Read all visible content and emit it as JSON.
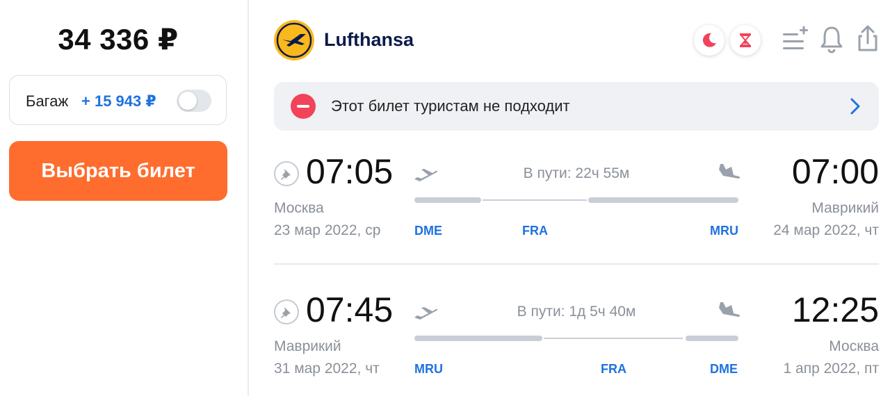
{
  "left": {
    "price": "34 336 ₽",
    "baggage_label": "Багаж",
    "baggage_price": "+ 15 943 ₽",
    "baggage_enabled": false,
    "select_button": "Выбрать билет"
  },
  "header": {
    "airline": "Lufthansa",
    "icons": [
      "night-flight-icon",
      "long-layover-icon",
      "add-to-list-icon",
      "bell-icon",
      "share-icon"
    ]
  },
  "banner": {
    "text": "Этот билет туристам не подходит"
  },
  "segments": [
    {
      "dep_time": "07:05",
      "dep_city": "Москва",
      "dep_date": "23 мар 2022, ср",
      "duration": "В пути: 22ч 55м",
      "arr_time": "07:00",
      "arr_city": "Маврикий",
      "arr_date": "24 мар 2022, чт",
      "codes": [
        "DME",
        "FRA",
        "MRU"
      ]
    },
    {
      "dep_time": "07:45",
      "dep_city": "Маврикий",
      "dep_date": "31 мар 2022, чт",
      "duration": "В пути: 1д 5ч 40м",
      "arr_time": "12:25",
      "arr_city": "Москва",
      "arr_date": "1 апр 2022, пт",
      "codes": [
        "MRU",
        "FRA",
        "DME"
      ]
    }
  ],
  "colors": {
    "accent_orange": "#ff6d2e",
    "link_blue": "#1e72e0",
    "logo_yellow": "#f9b81c",
    "warning_red": "#f1435a",
    "muted_gray": "#8a9099"
  }
}
